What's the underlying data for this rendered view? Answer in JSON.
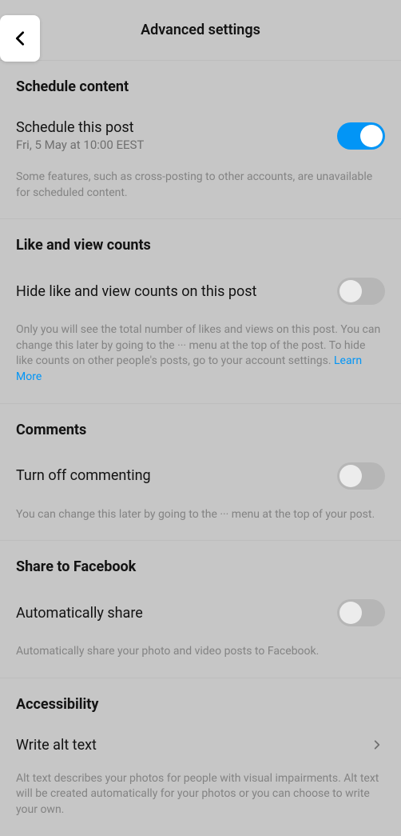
{
  "header": {
    "title": "Advanced settings"
  },
  "schedule": {
    "heading": "Schedule content",
    "row_title": "Schedule this post",
    "row_subtitle": "Fri, 5 May at 10:00 EEST",
    "description": "Some features, such as cross-posting to other accounts, are unavailable for scheduled content."
  },
  "likes": {
    "heading": "Like and view counts",
    "row_title": "Hide like and view counts on this post",
    "description": "Only you will see the total number of likes and views on this post. You can change this later by going to the ··· menu at the top of the post. To hide like counts on other people's posts, go to your account settings. ",
    "learn_more": "Learn More"
  },
  "comments": {
    "heading": "Comments",
    "row_title": "Turn off commenting",
    "description": "You can change this later by going to the ··· menu at the top of your post."
  },
  "facebook": {
    "heading": "Share to Facebook",
    "row_title": "Automatically share",
    "description": "Automatically share your photo and video posts to Facebook."
  },
  "accessibility": {
    "heading": "Accessibility",
    "row_title": "Write alt text",
    "description": "Alt text describes your photos for people with visual impairments. Alt text will be created automatically for your photos or you can choose to write your own."
  }
}
